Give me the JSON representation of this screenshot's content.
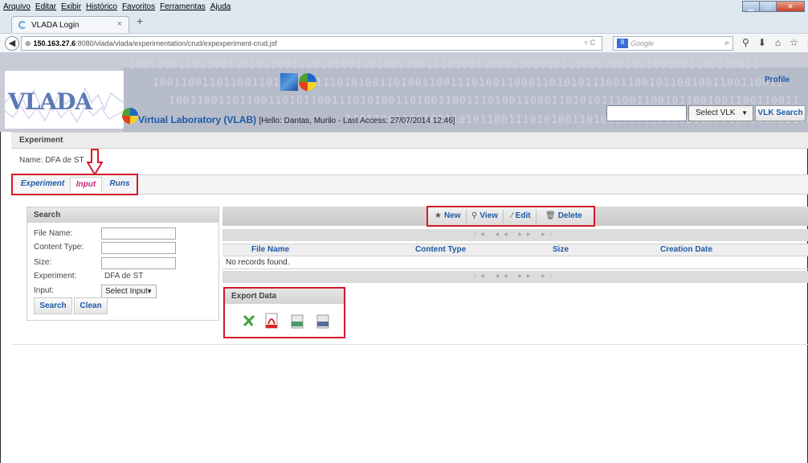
{
  "menubar": {
    "items": [
      "Arquivo",
      "Editar",
      "Exibir",
      "Histórico",
      "Favoritos",
      "Ferramentas",
      "Ajuda"
    ]
  },
  "browser": {
    "tab_title": "VLADA Login",
    "tab_close": "×",
    "new_tab": "+",
    "url_host": "150.163.27.6",
    "url_rest": ":8080/vlada/vlada/experimentation/crud/expexperiment-crud.jsf",
    "search_engine_placeholder": "Google"
  },
  "header": {
    "logo_text": "VLADA",
    "title": "Virtual Laboratory (VLAB)",
    "hello": "[Hello: Dantas, Murilo - Last Access: 27/07/2014 12:46]",
    "profile_link": "Profile",
    "select_vlk": "Select VLK",
    "vlk_search_button": "VLK Search",
    "binary_text": "10011001101100110101100111010100110100110011101001100011010101110011001011001001100110011"
  },
  "experiment": {
    "section_title": "Experiment",
    "name_label": "Name:",
    "name_value": "DFA de ST"
  },
  "tabs": [
    {
      "label": "Experiment",
      "active": false
    },
    {
      "label": "Input",
      "active": true
    },
    {
      "label": "Runs",
      "active": false
    }
  ],
  "search_panel": {
    "title": "Search",
    "fields": [
      {
        "label": "File Name:"
      },
      {
        "label": "Content Type:"
      },
      {
        "label": "Size:"
      }
    ],
    "experiment_label": "Experiment:",
    "experiment_value": "DFA de ST",
    "input_label": "Input:",
    "input_select": "Select Input",
    "search_button": "Search",
    "clean_button": "Clean"
  },
  "toolbar": {
    "new_label": "New",
    "view_label": "View",
    "edit_label": "Edit",
    "delete_label": "Delete"
  },
  "table": {
    "columns": [
      "File Name",
      "Content Type",
      "Size",
      "Creation Date"
    ],
    "empty_message": "No records found."
  },
  "export": {
    "title": "Export Data",
    "formats": [
      "xls-icon",
      "pdf-icon",
      "csv-icon",
      "xml-icon"
    ]
  },
  "colors": {
    "accent_blue": "#1c5aa6",
    "highlight_red": "#d6182c",
    "active_tab": "#c62a72"
  }
}
